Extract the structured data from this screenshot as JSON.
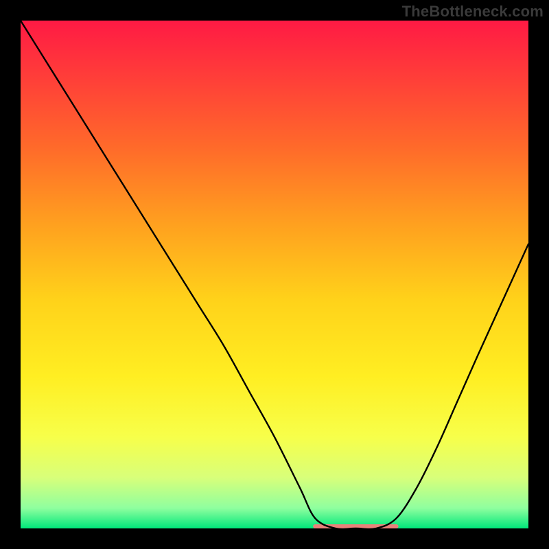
{
  "watermark": "TheBottleneck.com",
  "chart_data": {
    "type": "line",
    "title": "",
    "xlabel": "",
    "ylabel": "",
    "xlim": [
      0,
      100
    ],
    "ylim": [
      0,
      100
    ],
    "grid": false,
    "legend": false,
    "background_gradient": {
      "stops": [
        {
          "offset": 0.0,
          "color": "#ff1a44"
        },
        {
          "offset": 0.1,
          "color": "#ff3a3a"
        },
        {
          "offset": 0.25,
          "color": "#ff6a2a"
        },
        {
          "offset": 0.4,
          "color": "#ffa01f"
        },
        {
          "offset": 0.55,
          "color": "#ffd21a"
        },
        {
          "offset": 0.7,
          "color": "#ffee22"
        },
        {
          "offset": 0.82,
          "color": "#f7ff4a"
        },
        {
          "offset": 0.9,
          "color": "#d8ff7a"
        },
        {
          "offset": 0.96,
          "color": "#8fff9f"
        },
        {
          "offset": 1.0,
          "color": "#00e77a"
        }
      ]
    },
    "series": [
      {
        "name": "bottleneck-curve",
        "color": "#000000",
        "x": [
          0,
          5,
          10,
          15,
          20,
          25,
          30,
          35,
          40,
          45,
          50,
          55,
          58,
          62,
          66,
          70,
          74,
          78,
          82,
          86,
          90,
          95,
          100
        ],
        "y": [
          100,
          92,
          84,
          76,
          68,
          60,
          52,
          44,
          36,
          27,
          18,
          8,
          2,
          0,
          0,
          0,
          2,
          8,
          16,
          25,
          34,
          45,
          56
        ]
      }
    ],
    "flat_region_marker": {
      "color": "#e9817a",
      "x_start": 58,
      "x_end": 74,
      "y": 0,
      "thickness": 6
    }
  }
}
